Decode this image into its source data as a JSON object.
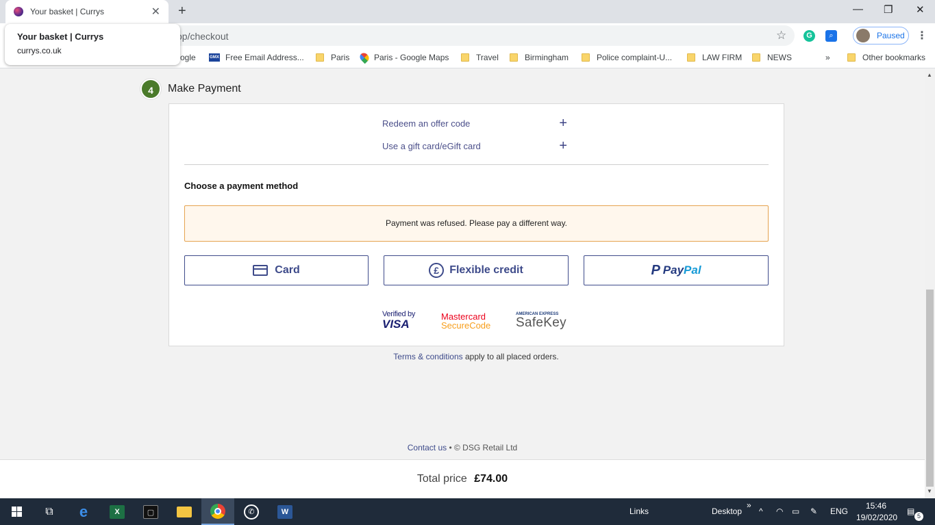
{
  "browser": {
    "tab_title": "Your basket | Currys",
    "url": "op/checkout",
    "tooltip": {
      "title": "Your basket | Currys",
      "domain": "currys.co.uk"
    },
    "profile_label": "Paused",
    "bookmarks": [
      {
        "label": "ogle",
        "icon": "none"
      },
      {
        "label": "Free Email Address...",
        "icon": "gmx"
      },
      {
        "label": "Paris",
        "icon": "folder"
      },
      {
        "label": "Paris - Google Maps",
        "icon": "maps"
      },
      {
        "label": "Travel",
        "icon": "folder"
      },
      {
        "label": "Birmingham",
        "icon": "folder"
      },
      {
        "label": "Police complaint-U...",
        "icon": "folder"
      },
      {
        "label": "LAW FIRM",
        "icon": "folder"
      },
      {
        "label": "NEWS",
        "icon": "folder"
      },
      {
        "label": "Other bookmarks",
        "icon": "folder"
      }
    ],
    "gmx_text": "GMX",
    "more_bookmarks": "»"
  },
  "step": {
    "number": "4",
    "title": "Make Payment"
  },
  "offers": {
    "redeem_label": "Redeem an offer code",
    "gift_label": "Use a gift card/eGift card"
  },
  "payment": {
    "heading": "Choose a payment method",
    "error": "Payment was refused. Please pay a different way.",
    "card_label": "Card",
    "credit_label": "Flexible credit",
    "paypal_pay": "Pay",
    "paypal_pal": "Pal"
  },
  "logos": {
    "visa_top": "Verified by",
    "visa_bottom": "VISA",
    "mc_top": "Mastercard",
    "mc_bottom": "SecureCode",
    "amex_top": "AMERICAN EXPRESS",
    "amex_bottom": "SafeKey"
  },
  "terms": {
    "link": "Terms & conditions",
    "rest": " apply to all placed orders."
  },
  "footer": {
    "contact": "Contact us",
    "copyright": " • © DSG Retail Ltd"
  },
  "total": {
    "label": "Total price",
    "value": "£74.00"
  },
  "taskbar": {
    "links": "Links",
    "desktop": "Desktop",
    "lang": "ENG",
    "time": "15:46",
    "date": "19/02/2020",
    "notifications": "5"
  }
}
